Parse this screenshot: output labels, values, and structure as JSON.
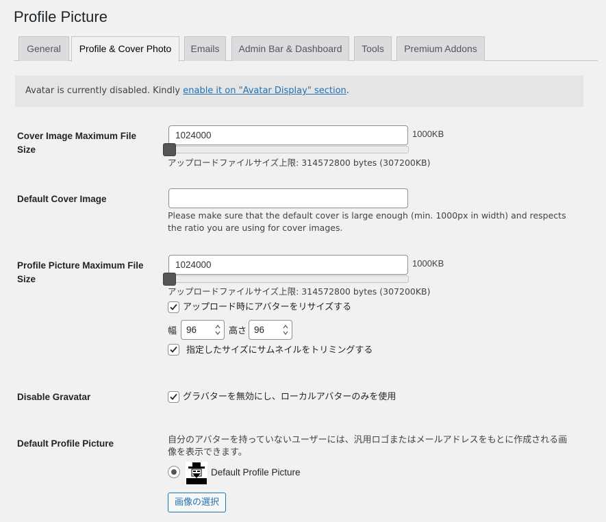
{
  "page": {
    "title": "Profile Picture"
  },
  "tabs": [
    {
      "label": "General",
      "active": false
    },
    {
      "label": "Profile & Cover Photo",
      "active": true
    },
    {
      "label": "Emails",
      "active": false
    },
    {
      "label": "Admin Bar & Dashboard",
      "active": false
    },
    {
      "label": "Tools",
      "active": false
    },
    {
      "label": "Premium Addons",
      "active": false
    }
  ],
  "notice": {
    "text": "Avatar is currently disabled. Kindly ",
    "link": "enable it on \"Avatar Display\" section",
    "suffix": "."
  },
  "cover_max_size": {
    "label": "Cover Image Maximum File Size",
    "value": "1024000",
    "unit": "1000KB",
    "slider_fraction": 0.0,
    "limit_text": "アップロードファイルサイズ上限: 314572800 bytes (307200KB)"
  },
  "default_cover": {
    "label": "Default Cover Image",
    "value": "",
    "description": "Please make sure that the default cover is large enough (min. 1000px in width) and respects the ratio you are using for cover images."
  },
  "profile_max_size": {
    "label": "Profile Picture Maximum File Size",
    "value": "1024000",
    "unit": "1000KB",
    "slider_fraction": 0.0,
    "limit_text": "アップロードファイルサイズ上限: 314572800 bytes (307200KB)",
    "resize_label": "アップロード時にアバターをリサイズする",
    "resize_checked": true,
    "width_label": "幅",
    "width_value": "96",
    "height_label": "高さ",
    "height_value": "96",
    "crop_label": "指定したサイズにサムネイルをトリミングする",
    "crop_checked": true
  },
  "disable_gravatar": {
    "label": "Disable Gravatar",
    "checkbox_label": "グラバターを無効にし、ローカルアバターのみを使用",
    "checked": true
  },
  "default_profile_picture": {
    "label": "Default Profile Picture",
    "description": "自分のアバターを持っていないユーザーには、汎用ロゴまたはメールアドレスをもとに作成される画像を表示できます。",
    "option_label": "Default Profile Picture",
    "selected": true,
    "button_label": "画像の選択"
  },
  "colors": {
    "accent": "#2271b1",
    "background": "#f1f1f1",
    "notice_bg": "#e5e5e5"
  }
}
